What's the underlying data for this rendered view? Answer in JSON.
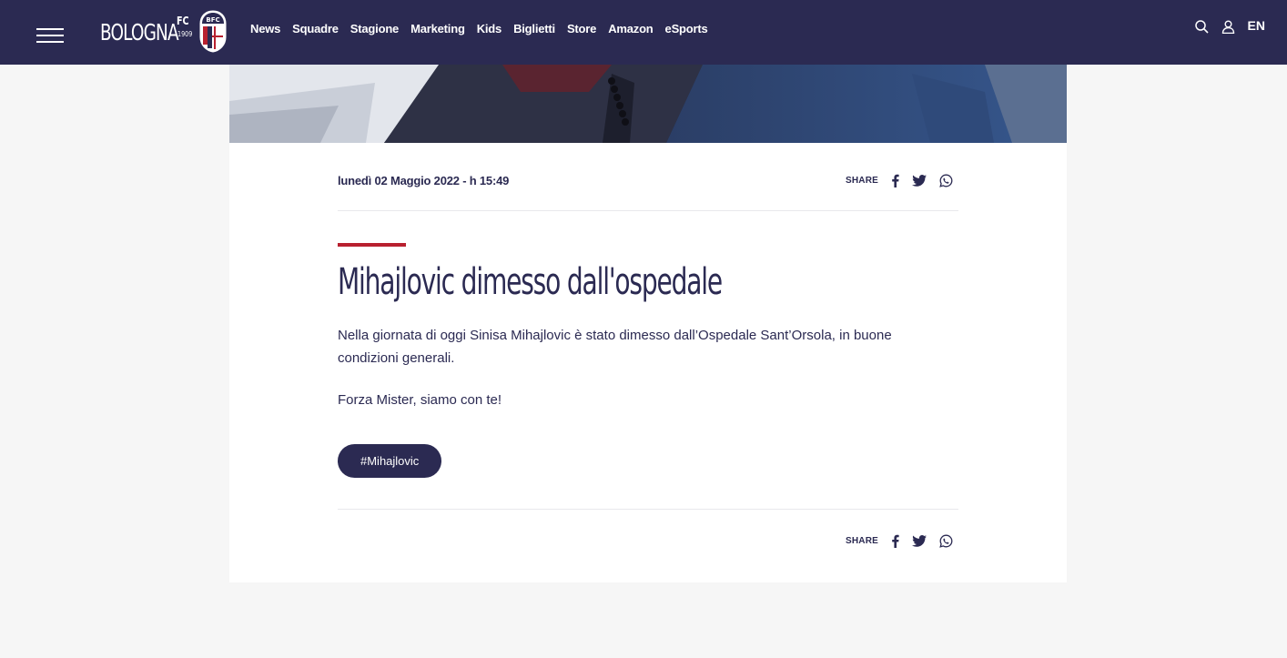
{
  "header": {
    "logo_text": "BOLOGNA",
    "logo_fc": "FC",
    "logo_year": "1909",
    "nav": [
      {
        "label": "News"
      },
      {
        "label": "Squadre"
      },
      {
        "label": "Stagione"
      },
      {
        "label": "Marketing"
      },
      {
        "label": "Kids"
      },
      {
        "label": "Biglietti"
      },
      {
        "label": "Store"
      },
      {
        "label": "Amazon"
      },
      {
        "label": "eSports"
      }
    ],
    "lang": "EN",
    "icons": [
      "menu-icon",
      "search-icon",
      "user-icon"
    ],
    "colors": {
      "bar": "#2b2a52",
      "accent": "#b8202f"
    }
  },
  "article": {
    "date": "lunedì 02 Maggio 2022 - h 15:49",
    "share_label": "SHARE",
    "share_icons": [
      "facebook-icon",
      "twitter-icon",
      "whatsapp-icon"
    ],
    "title": "Mihajlovic dimesso dall'ospedale",
    "paragraphs": [
      "Nella giornata di oggi Sinisa Mihajlovic è stato dimesso dall’Ospedale Sant’Orsola, in buone condizioni generali.",
      "Forza Mister, siamo con te!"
    ],
    "tag": "#Mihajlovic"
  }
}
